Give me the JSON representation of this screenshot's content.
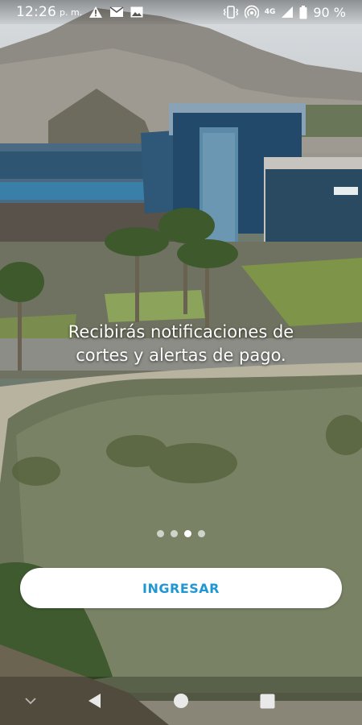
{
  "status_bar": {
    "time": "12:26",
    "ampm": "p. m.",
    "network_type": "4G",
    "battery_percent": "90 %",
    "left_icons": [
      "warning-icon",
      "gmail-icon",
      "image-icon"
    ],
    "right_icons": [
      "vibrate-icon",
      "hotspot-icon",
      "network-4g-icon",
      "signal-icon",
      "battery-icon"
    ]
  },
  "onboarding": {
    "message": "Recibirás notificaciones de cortes y alertas de pago.",
    "page_count": 4,
    "active_page": 3
  },
  "actions": {
    "login_label": "INGRESAR"
  },
  "colors": {
    "accent": "#1f97d4",
    "button_bg": "#ffffff",
    "text": "#ffffff"
  },
  "nav_bar": {
    "buttons": [
      "chevron-down-icon",
      "back-icon",
      "home-icon",
      "recents-icon"
    ]
  }
}
